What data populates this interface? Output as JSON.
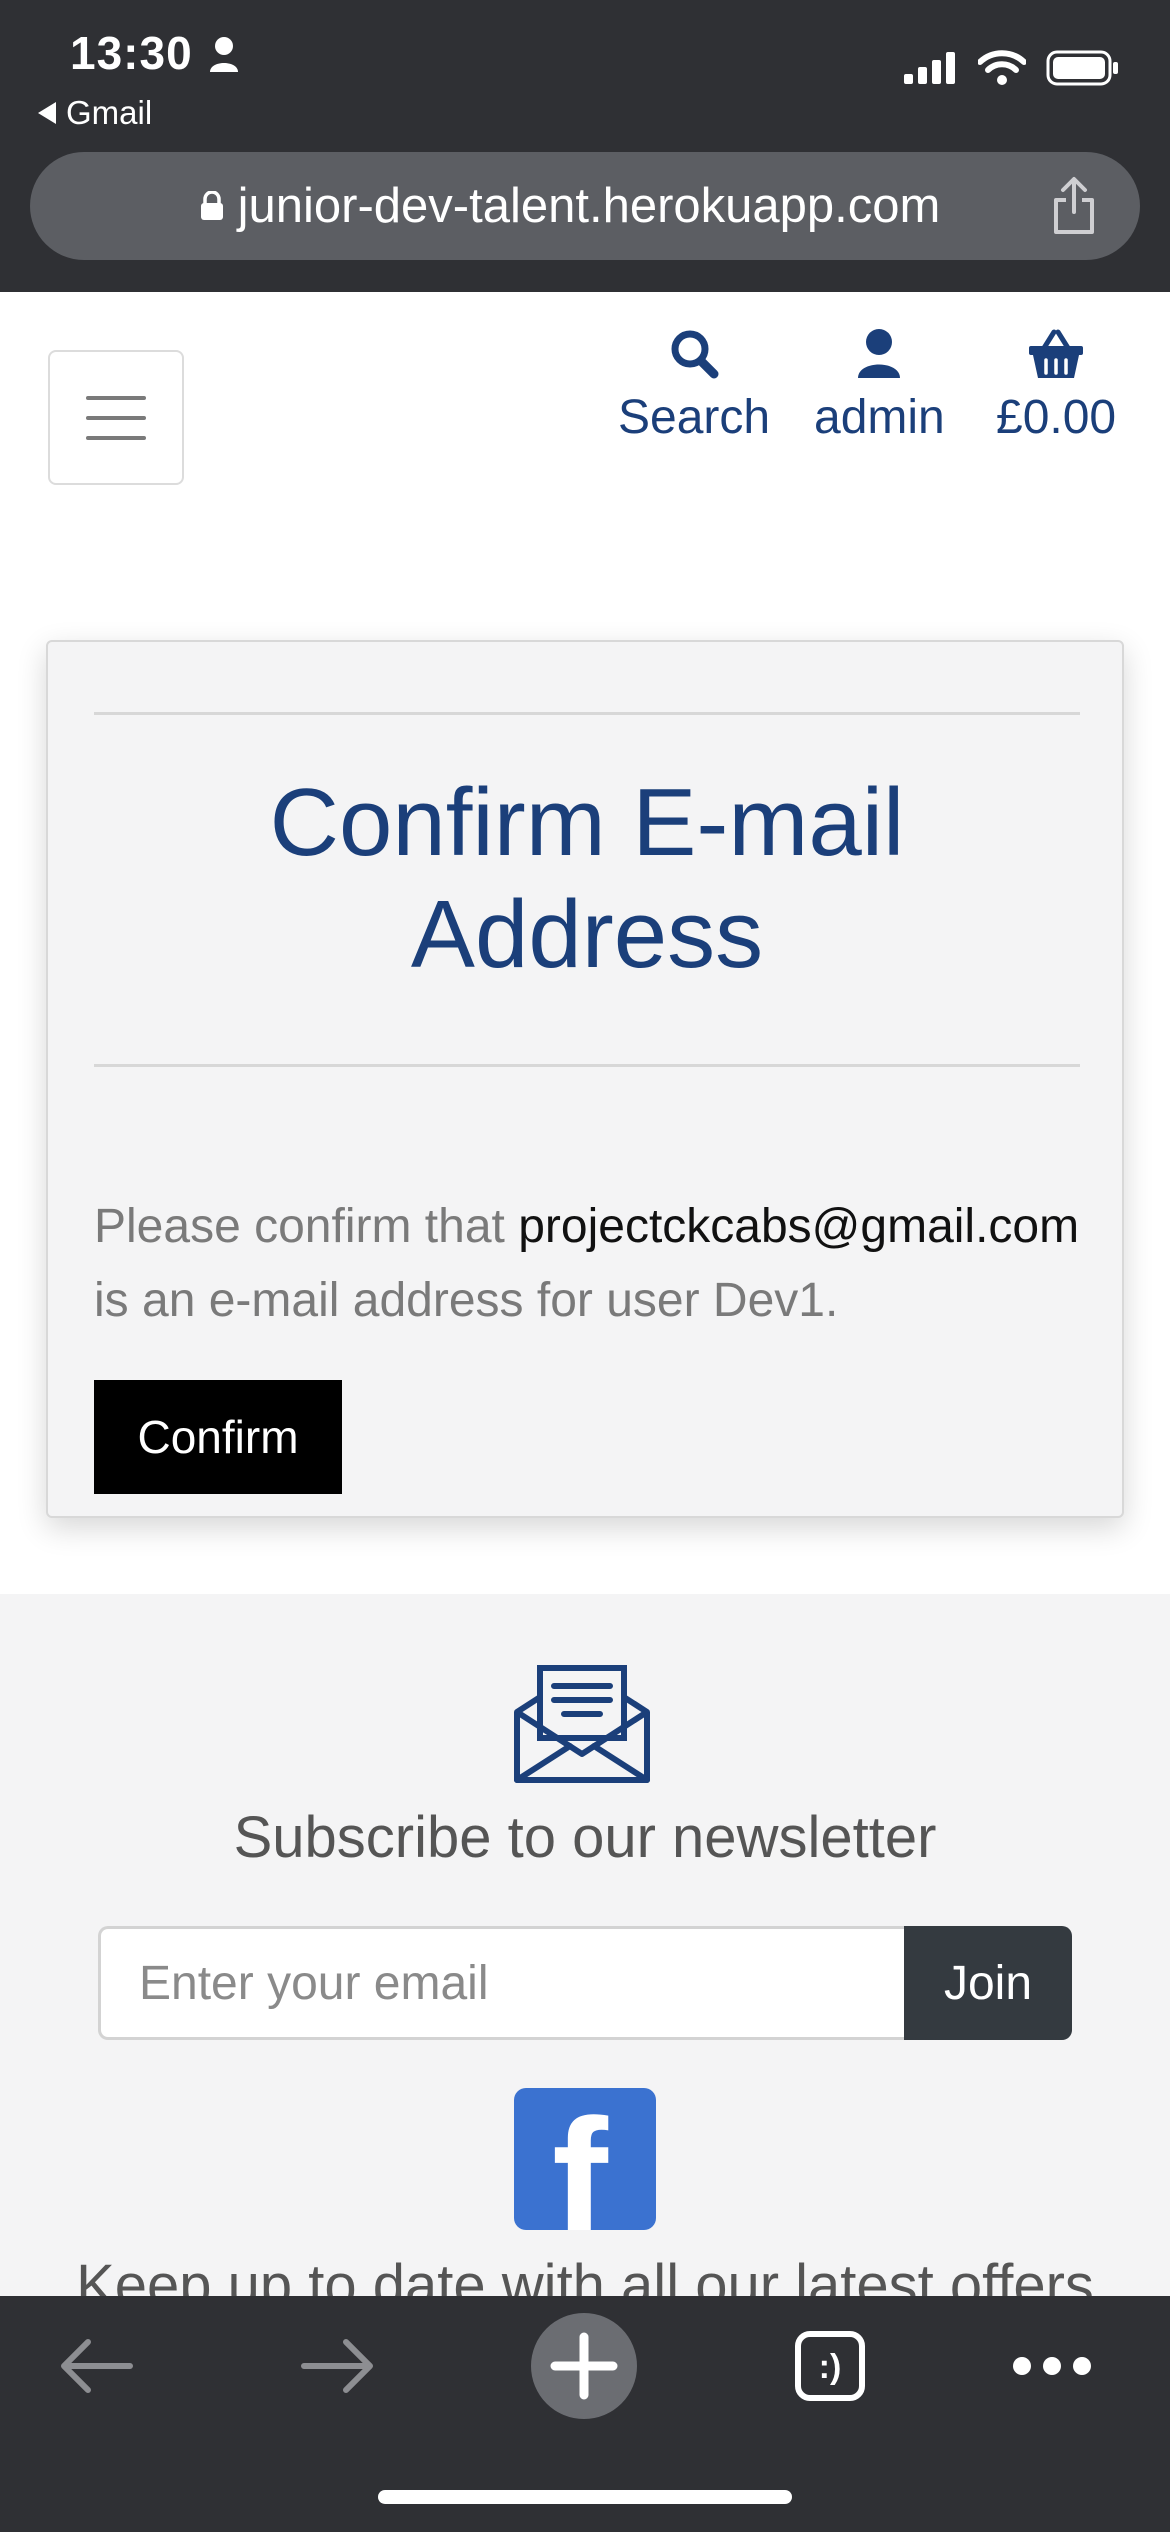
{
  "status_bar": {
    "time": "13:30",
    "back_app": "Gmail"
  },
  "browser": {
    "url": "junior-dev-talent.herokuapp.com"
  },
  "header": {
    "search_label": "Search",
    "account_label": "admin",
    "basket_total": "£0.00"
  },
  "confirm_card": {
    "title": "Confirm E-mail Address",
    "text_before": "Please confirm that ",
    "email": "projectckcabs@gmail.com",
    "text_after": " is an e-mail address for user Dev1.",
    "button_label": "Confirm"
  },
  "newsletter": {
    "title": "Subscribe to our newsletter",
    "email_placeholder": "Enter your email",
    "join_label": "Join",
    "social_text": "Keep up to date with all our latest offers"
  },
  "toolbar": {
    "tabs_label": ":)"
  },
  "colors": {
    "brand": "#1b3f7a",
    "chrome": "#2f3034",
    "facebook": "#3b72d0"
  }
}
